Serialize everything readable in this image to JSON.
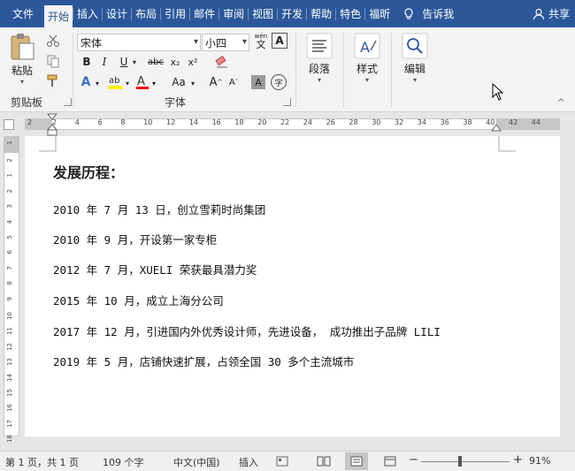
{
  "tabs": [
    {
      "label": "文件"
    },
    {
      "label": "开始",
      "active": true
    },
    {
      "label": "插入"
    },
    {
      "label": "设计"
    },
    {
      "label": "布局"
    },
    {
      "label": "引用"
    },
    {
      "label": "邮件"
    },
    {
      "label": "审阅"
    },
    {
      "label": "视图"
    },
    {
      "label": "开发"
    },
    {
      "label": "帮助"
    },
    {
      "label": "特色"
    },
    {
      "label": "福昕"
    }
  ],
  "tell_me": "告诉我",
  "share": "共享",
  "ribbon": {
    "clipboard_label": "剪贴板",
    "paste_label": "粘贴",
    "font_label": "字体",
    "font_name": "宋体",
    "font_size": "小四",
    "wen_icon_text": "wén",
    "wen_char": "文",
    "bold": "B",
    "italic": "I",
    "underline": "U",
    "strike": "abc",
    "sub": "x₂",
    "sup": "x²",
    "grow": "A",
    "shrink": "A",
    "aa": "Aa",
    "char_border": "A",
    "char_shade": "A",
    "phonetic": "字",
    "paragraph_label": "段落",
    "styles_label": "样式",
    "edit_label": "编辑"
  },
  "ruler": {
    "ticks": [
      "2",
      "2",
      "4",
      "6",
      "8",
      "10",
      "12",
      "14",
      "16",
      "18",
      "20",
      "22",
      "24",
      "26",
      "28",
      "30",
      "32",
      "34",
      "36",
      "38",
      "40",
      "42",
      "44"
    ]
  },
  "vruler": {
    "ticks": [
      "1",
      "2",
      "1",
      "2",
      "3",
      "4",
      "5",
      "6",
      "7",
      "8",
      "9",
      "10",
      "11",
      "12",
      "13",
      "14",
      "15",
      "16",
      "17",
      "18"
    ]
  },
  "document": {
    "heading": "发展历程：",
    "lines": [
      "2010 年 7 月 13 日，创立雪莉时尚集团",
      "2010 年 9 月，开设第一家专柜",
      "2012 年 7 月，XUELI 荣获最具潜力奖",
      "2015 年 10 月，成立上海分公司",
      "2017 年 12 月，引进国内外优秀设计师，先进设备， 成功推出子品牌 LILI",
      "2019 年 5 月，店铺快速扩展，占领全国 30 多个主流城市"
    ]
  },
  "status": {
    "page": "第 1 页，共 1 页",
    "words": "109 个字",
    "language": "中文(中国)",
    "mode": "插入",
    "zoom": "91%",
    "minus": "−",
    "plus": "+"
  }
}
